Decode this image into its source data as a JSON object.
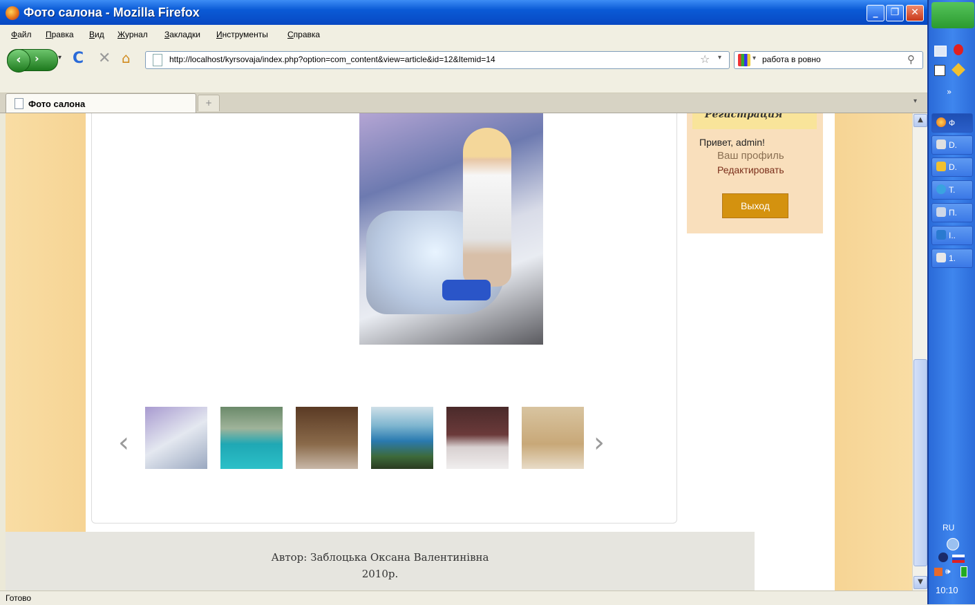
{
  "window": {
    "title": "Фото салона - Mozilla Firefox"
  },
  "menu": [
    "Файл",
    "Правка",
    "Вид",
    "Журнал",
    "Закладки",
    "Инструменты",
    "Справка"
  ],
  "nav": {
    "url": "http://localhost/kyrsovaja/index.php?option=com_content&view=article&id=12&Itemid=14",
    "search": "работа в ровно"
  },
  "tab": {
    "label": "Фото салона",
    "newtab": "+"
  },
  "sidebar": {
    "heading": "Регистрация",
    "greeting": "Привет, admin!",
    "profile": "Ваш профиль",
    "edit": "Редактировать",
    "logout": "Выход"
  },
  "gallery": {
    "prev": "‹",
    "next": "›"
  },
  "footer": {
    "author": "Автор: Заблоцька Оксана Валентинівна",
    "year": "2010р."
  },
  "status": "Готово",
  "taskbar": {
    "items": [
      "Ф",
      "D.",
      "D.",
      "T.",
      "П.",
      "I..",
      "1."
    ],
    "lang": "RU",
    "clock": "10:10"
  },
  "colors": {
    "page_bg": "#f7d89f",
    "logout_btn": "#d4920f",
    "footer_bg": "#e6e5df"
  }
}
